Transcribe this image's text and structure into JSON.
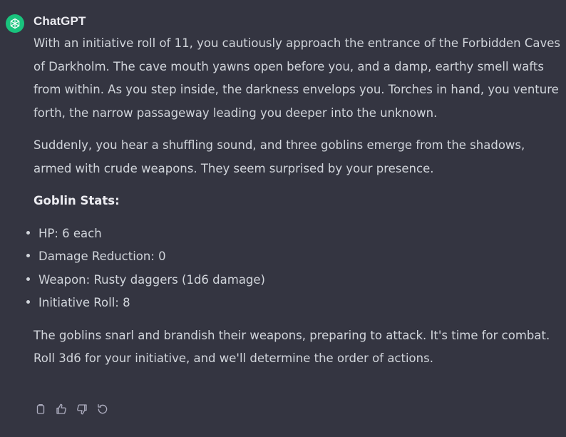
{
  "message": {
    "author": "ChatGPT",
    "paragraphs": [
      "With an initiative roll of 11, you cautiously approach the entrance of the Forbidden Caves of Darkholm. The cave mouth yawns open before you, and a damp, earthy smell wafts from within. As you step inside, the darkness envelops you. Torches in hand, you venture forth, the narrow passageway leading you deeper into the unknown.",
      "Suddenly, you hear a shuffling sound, and three goblins emerge from the shadows, armed with crude weapons. They seem surprised by your presence."
    ],
    "stats_heading": "Goblin Stats:",
    "stats": [
      "HP: 6 each",
      "Damage Reduction: 0",
      "Weapon: Rusty daggers (1d6 damage)",
      "Initiative Roll: 8"
    ],
    "closing": "The goblins snarl and brandish their weapons, preparing to attack. It's time for combat. Roll 3d6 for your initiative, and we'll determine the order of actions."
  },
  "actions": {
    "icons": [
      "clipboard-icon",
      "thumbs-up-icon",
      "thumbs-down-icon",
      "regenerate-icon"
    ]
  },
  "colors": {
    "background": "#343541",
    "avatar": "#19c37d",
    "text": "#d1d5db",
    "icon": "#acacbe"
  }
}
